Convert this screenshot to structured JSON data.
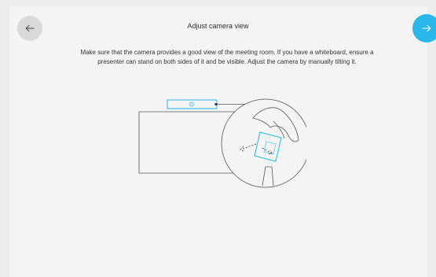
{
  "header": {
    "title": "Adjust camera view",
    "back_icon": "arrow-left-icon",
    "next_icon": "arrow-right-icon"
  },
  "content": {
    "instructions": "Make sure that the camera provides a good view of the meeting room. If you have a whiteboard, ensure a presenter can stand on both sides of it and be visible. Adjust the camera by manually tilting it."
  },
  "colors": {
    "accent": "#29b6e8",
    "background": "#f4f4f4",
    "back_button": "#d9d9d9",
    "illustration_line": "#555555"
  }
}
